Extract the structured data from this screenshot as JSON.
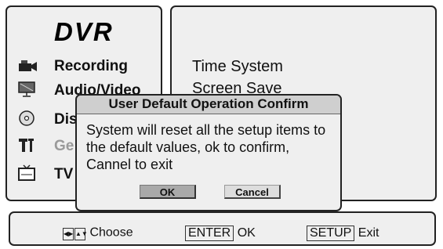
{
  "sidebar": {
    "title": "DVR",
    "items": [
      {
        "label": "Recording",
        "icon": "camcorder-icon"
      },
      {
        "label": "Audio/Video",
        "icon": "monitor-icon"
      },
      {
        "label": "Dis",
        "icon": "disc-icon"
      },
      {
        "label": "Ge",
        "icon": "tools-icon"
      },
      {
        "label": "TV",
        "icon": "tv-icon"
      }
    ]
  },
  "options": [
    "Time System",
    "Screen Save"
  ],
  "dialog": {
    "title": "User Default Operation Confirm",
    "message": "System will reset all the setup items to the default values, ok to confirm, Cannel to exit",
    "ok_label": "OK",
    "cancel_label": "Cancel"
  },
  "footer": {
    "choose_label": "Choose",
    "enter_key": "ENTER",
    "enter_action": "OK",
    "setup_key": "SETUP",
    "setup_action": "Exit"
  }
}
